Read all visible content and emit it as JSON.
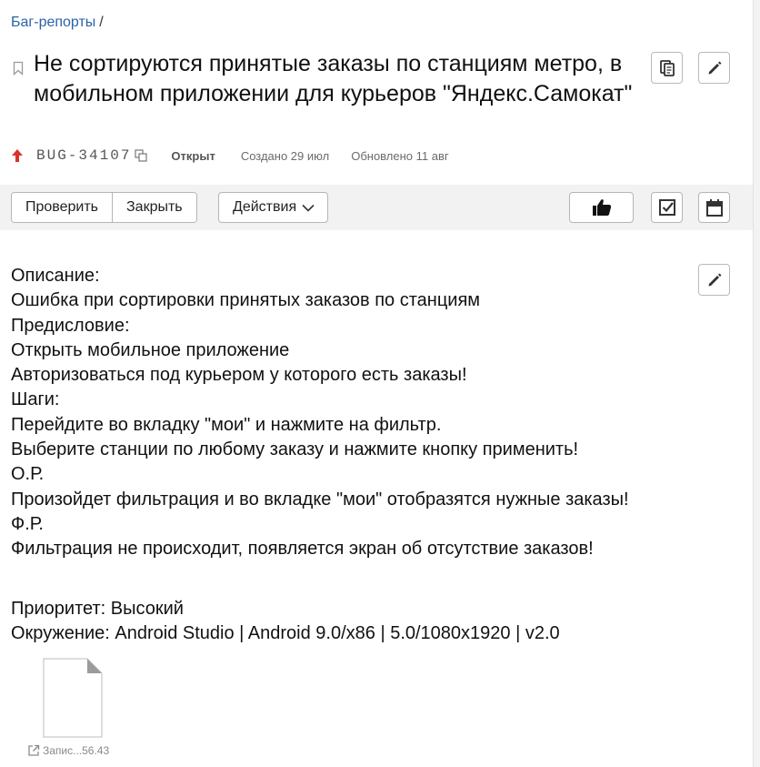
{
  "breadcrumb": {
    "link": "Баг-репорты",
    "separator": "/"
  },
  "issue": {
    "title": "Не сортируются принятые заказы по станциям метро, в мобильном приложении для курьеров \"Яндекс.Самокат\"",
    "key": "BUG-34107",
    "status": "Открыт",
    "created": "Создано 29 июл",
    "updated": "Обновлено 11 авг",
    "priority_color": "#d9322b"
  },
  "toolbar": {
    "verify_label": "Проверить",
    "close_label": "Закрыть",
    "actions_label": "Действия"
  },
  "icons": {
    "bookmark": "bookmark-icon",
    "copy": "copy-icon",
    "edit": "pencil-icon",
    "priority": "arrow-up-icon",
    "like": "thumbs-up-icon",
    "checklist": "checkbox-icon",
    "calendar": "calendar-icon",
    "file": "file-icon",
    "external": "external-link-icon"
  },
  "description": {
    "lines": [
      "Описание:",
      "Ошибка при сортировки принятых заказов по станциям",
      "Предисловие:",
      "Открыть мобильное приложение",
      "Авторизоваться под курьером у которого есть заказы!",
      "Шаги:",
      "Перейдите во вкладку \"мои\" и нажмите на фильтр.",
      "Выберите станции по любому заказу и нажмите кнопку применить!",
      "О.Р.",
      "Произойдет фильтрация и во вкладке \"мои\" отобразятся нужные заказы!",
      "Ф.Р.",
      "Фильтрация не происходит, появляется экран об отсутствие заказов!"
    ]
  },
  "fields": {
    "priority": "Приоритет: Высокий",
    "environment": "Окружение: Android Studio | Android 9.0/x86 | 5.0/1080x1920 | v2.0"
  },
  "attachment": {
    "name": "Запис...56.43"
  }
}
